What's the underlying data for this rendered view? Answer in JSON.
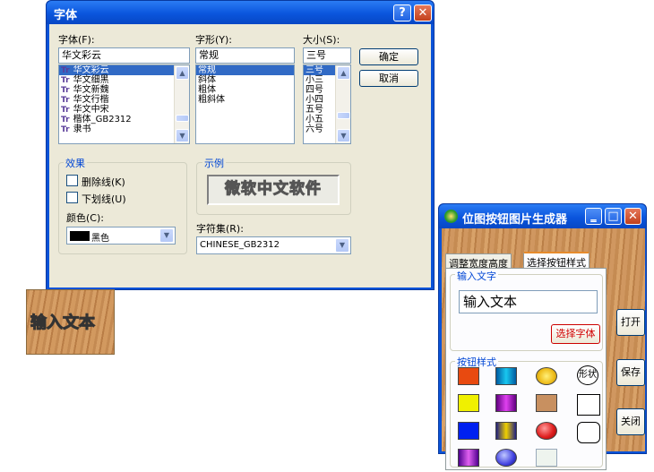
{
  "font_dialog": {
    "title": "字体",
    "help_glyph": "?",
    "close_glyph": "✕",
    "font_label": "字体(F):",
    "font_value": "华文彩云",
    "font_list": [
      "华文彩云",
      "华文细黑",
      "华文新魏",
      "华文行楷",
      "华文中宋",
      "楷体_GB2312",
      "隶书"
    ],
    "font_icon_text": "Tr",
    "style_label": "字形(Y):",
    "style_value": "常规",
    "style_list": [
      "常规",
      "斜体",
      "粗体",
      "粗斜体"
    ],
    "size_label": "大小(S):",
    "size_value": "三号",
    "size_list": [
      "三号",
      "小三",
      "四号",
      "小四",
      "五号",
      "小五",
      "六号"
    ],
    "ok_label": "确定",
    "cancel_label": "取消",
    "effects_title": "效果",
    "strikeout_label": "删除线(K)",
    "underline_label": "下划线(U)",
    "color_label": "颜色(C):",
    "color_value": "黑色",
    "color_swatch": "#000000",
    "sample_title": "示例",
    "sample_text": "微软中文软件",
    "charset_label": "字符集(R):",
    "charset_value": "CHINESE_GB2312"
  },
  "preview": {
    "text": "输入文本"
  },
  "generator": {
    "title": "位图按钮图片生成器",
    "tabs": [
      "调整宽度高度",
      "选择按钮样式"
    ],
    "input_group_title": "输入文字",
    "input_value": "输入文本",
    "choose_font_label": "选择字体",
    "style_group_title": "按钮样式",
    "shape_label": "形状",
    "open_label": "打开",
    "save_label": "保存",
    "close_label": "关闭",
    "swatch_colors": [
      "#e84a10",
      "#18a0e8",
      "#f0c020",
      "#f0f000",
      "#c020c0",
      "#c89060",
      "#0020f0",
      "#e0c010",
      "#e02020",
      "#8020d0",
      "#4040e0",
      "#d8e8d8"
    ]
  },
  "colors": {
    "titlebar": "#0a55dd",
    "selection": "#316ac5",
    "dialog_bg": "#ece9d8",
    "group_title": "#0046d5"
  }
}
